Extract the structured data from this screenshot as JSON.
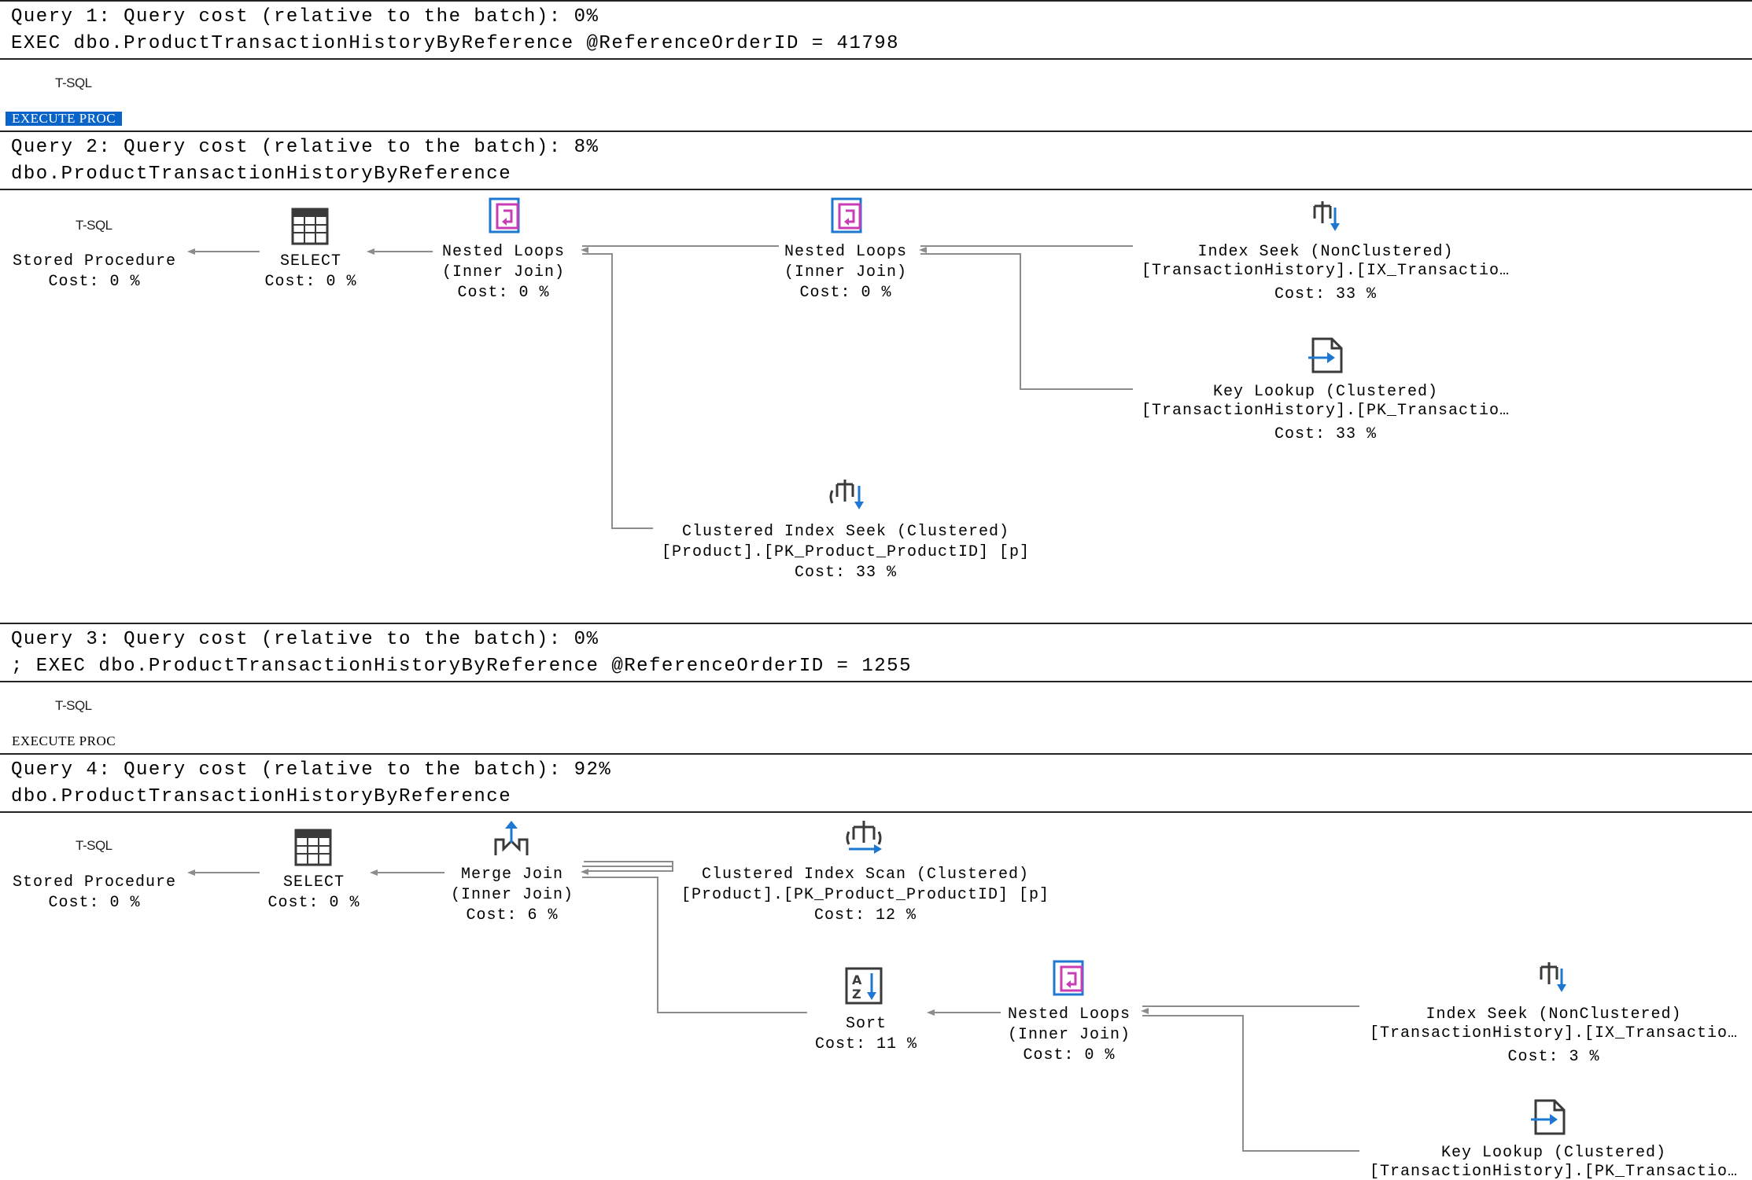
{
  "queries": [
    {
      "header": "Query 1: Query cost (relative to the batch): 0%",
      "statement": "EXEC dbo.ProductTransactionHistoryByReference @ReferenceOrderID = 41798",
      "tsql_label": "T-SQL",
      "operator": "EXECUTE PROC",
      "selected": true
    },
    {
      "header": "Query 2: Query cost (relative to the batch): 8%",
      "statement": "dbo.ProductTransactionHistoryByReference",
      "nodes": {
        "stored_procedure": {
          "tsql_label": "T-SQL",
          "name": "Stored Procedure",
          "cost": "Cost: 0 %"
        },
        "select": {
          "name": "SELECT",
          "cost": "Cost: 0 %"
        },
        "nested_loops_1": {
          "name": "Nested Loops",
          "sub": "(Inner Join)",
          "cost": "Cost: 0 %"
        },
        "nested_loops_2": {
          "name": "Nested Loops",
          "sub": "(Inner Join)",
          "cost": "Cost: 0 %"
        },
        "index_seek": {
          "name": "Index Seek (NonClustered)",
          "sub": "[TransactionHistory].[IX_Transactio…",
          "cost": "Cost: 33 %"
        },
        "key_lookup": {
          "name": "Key Lookup (Clustered)",
          "sub": "[TransactionHistory].[PK_Transactio…",
          "cost": "Cost: 33 %"
        },
        "clustered_seek": {
          "name": "Clustered Index Seek (Clustered)",
          "sub": "[Product].[PK_Product_ProductID] [p]",
          "cost": "Cost: 33 %"
        }
      }
    },
    {
      "header": "Query 3: Query cost (relative to the batch): 0%",
      "statement": "; EXEC dbo.ProductTransactionHistoryByReference @ReferenceOrderID = 1255",
      "tsql_label": "T-SQL",
      "operator": "EXECUTE PROC",
      "selected": false
    },
    {
      "header": "Query 4: Query cost (relative to the batch): 92%",
      "statement": "dbo.ProductTransactionHistoryByReference",
      "nodes": {
        "stored_procedure": {
          "tsql_label": "T-SQL",
          "name": "Stored Procedure",
          "cost": "Cost: 0 %"
        },
        "select": {
          "name": "SELECT",
          "cost": "Cost: 0 %"
        },
        "merge_join": {
          "name": "Merge Join",
          "sub": "(Inner Join)",
          "cost": "Cost: 6 %"
        },
        "clustered_scan": {
          "name": "Clustered Index Scan (Clustered)",
          "sub": "[Product].[PK_Product_ProductID] [p]",
          "cost": "Cost: 12 %"
        },
        "sort": {
          "name": "Sort",
          "cost": "Cost: 11 %"
        },
        "nested_loops": {
          "name": "Nested Loops",
          "sub": "(Inner Join)",
          "cost": "Cost: 0 %"
        },
        "index_seek": {
          "name": "Index Seek (NonClustered)",
          "sub": "[TransactionHistory].[IX_Transactio…",
          "cost": "Cost: 3 %"
        },
        "key_lookup": {
          "name": "Key Lookup (Clustered)",
          "sub": "[TransactionHistory].[PK_Transactio…"
        }
      }
    }
  ],
  "colors": {
    "selection": "#0a64c8",
    "arrow": "#8c8c8c",
    "icon_blue": "#1e78d2",
    "icon_magenta": "#c83cb4",
    "icon_dark": "#3a3a3a"
  }
}
